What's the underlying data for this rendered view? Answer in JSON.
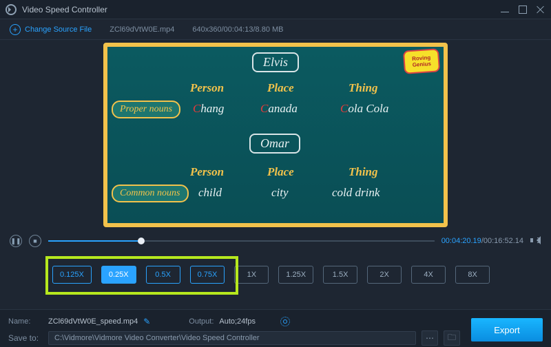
{
  "titlebar": {
    "title": "Video Speed Controller"
  },
  "toolbar": {
    "change_source": "Change Source File",
    "filename": "ZCl69dVtW0E.mp4",
    "metadata": "640x360/00:04:13/8.80 MB"
  },
  "video_content": {
    "badge_top": "Roving",
    "badge_bottom": "Genius",
    "name1": "Elvis",
    "name2": "Omar",
    "headers": {
      "person": "Person",
      "place": "Place",
      "thing": "Thing"
    },
    "tag1": "Proper nouns",
    "row1": {
      "person_c": "C",
      "person_rest": "hang",
      "place_c": "C",
      "place_rest": "anada",
      "thing_c": "C",
      "thing_rest": "ola Cola"
    },
    "tag2": "Common nouns",
    "row2": {
      "person": "child",
      "place": "city",
      "thing": "cold drink"
    }
  },
  "transport": {
    "current": "00:04:20.19",
    "sep": "/",
    "total": "00:16:52.14"
  },
  "speeds": {
    "items": [
      {
        "label": "0.125X",
        "sel": false,
        "grey": false
      },
      {
        "label": "0.25X",
        "sel": true,
        "grey": false
      },
      {
        "label": "0.5X",
        "sel": false,
        "grey": false
      },
      {
        "label": "0.75X",
        "sel": false,
        "grey": false
      },
      {
        "label": "1X",
        "sel": false,
        "grey": true
      },
      {
        "label": "1.25X",
        "sel": false,
        "grey": true
      },
      {
        "label": "1.5X",
        "sel": false,
        "grey": true
      },
      {
        "label": "2X",
        "sel": false,
        "grey": true
      },
      {
        "label": "4X",
        "sel": false,
        "grey": true
      },
      {
        "label": "8X",
        "sel": false,
        "grey": true
      }
    ]
  },
  "bottom": {
    "name_label": "Name:",
    "name_value": "ZCl69dVtW0E_speed.mp4",
    "output_label": "Output:",
    "output_value": "Auto;24fps",
    "saveto_label": "Save to:",
    "saveto_value": "C:\\Vidmore\\Vidmore Video Converter\\Video Speed Controller",
    "export": "Export"
  }
}
